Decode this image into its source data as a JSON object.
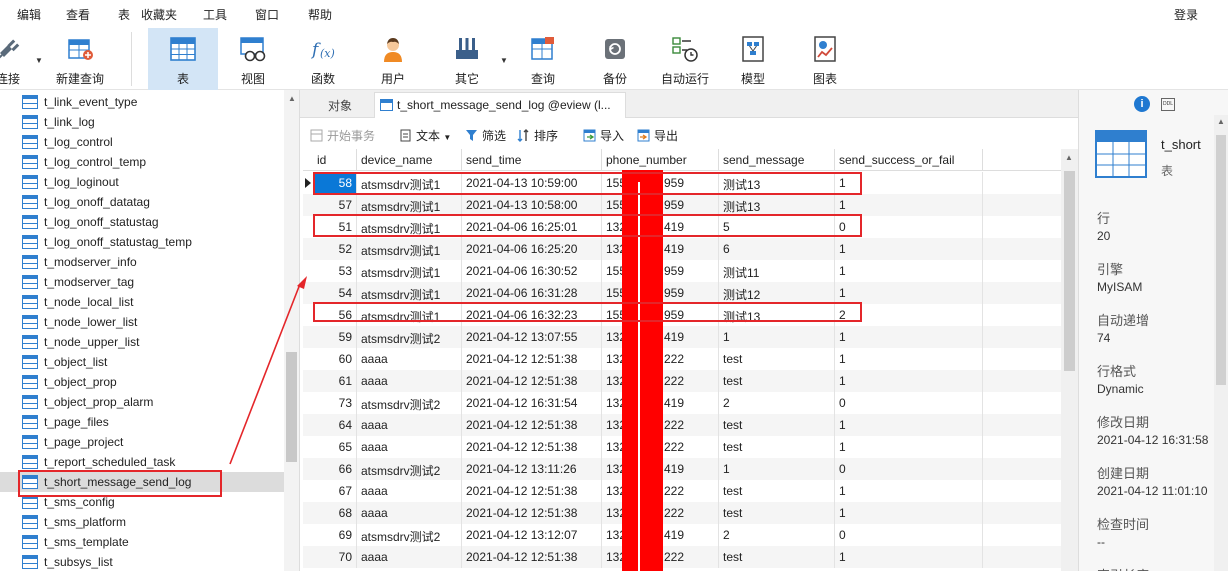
{
  "menu": [
    "编辑",
    "查看",
    "表",
    "收藏夹",
    "工具",
    "窗口",
    "帮助"
  ],
  "login": "登录",
  "toolbar": [
    {
      "label": "连接",
      "icon": "connection-icon"
    },
    {
      "label": "新建查询",
      "icon": "new-query-icon"
    },
    {
      "label": "表",
      "icon": "table-icon",
      "active": true
    },
    {
      "label": "视图",
      "icon": "view-icon"
    },
    {
      "label": "函数",
      "icon": "function-icon"
    },
    {
      "label": "用户",
      "icon": "user-icon"
    },
    {
      "label": "其它",
      "icon": "tools-icon"
    },
    {
      "label": "查询",
      "icon": "query-icon"
    },
    {
      "label": "备份",
      "icon": "backup-icon"
    },
    {
      "label": "自动运行",
      "icon": "automation-icon"
    },
    {
      "label": "模型",
      "icon": "model-icon"
    },
    {
      "label": "图表",
      "icon": "chart-icon"
    }
  ],
  "tree_items": [
    "t_link_event_type",
    "t_link_log",
    "t_log_control",
    "t_log_control_temp",
    "t_log_loginout",
    "t_log_onoff_datatag",
    "t_log_onoff_statustag",
    "t_log_onoff_statustag_temp",
    "t_modserver_info",
    "t_modserver_tag",
    "t_node_local_list",
    "t_node_lower_list",
    "t_node_upper_list",
    "t_object_list",
    "t_object_prop",
    "t_object_prop_alarm",
    "t_page_files",
    "t_page_project",
    "t_report_scheduled_task",
    "t_short_message_send_log",
    "t_sms_config",
    "t_sms_platform",
    "t_sms_template",
    "t_subsys_list"
  ],
  "selected_tree_index": 19,
  "tabs": {
    "objects": "对象",
    "active": "t_short_message_send_log @eview (l..."
  },
  "subtoolbar": {
    "begin_tx": "开始事务",
    "text": "文本",
    "filter": "筛选",
    "sort": "排序",
    "import": "导入",
    "export": "导出"
  },
  "columns": [
    "id",
    "device_name",
    "send_time",
    "phone_number",
    "send_message",
    "send_success_or_fail"
  ],
  "rows": [
    [
      "58",
      "atsmsdrv测试1",
      "2021-04-13 10:59:00",
      "155",
      "959",
      "测试13",
      "1"
    ],
    [
      "57",
      "atsmsdrv测试1",
      "2021-04-13 10:58:00",
      "155",
      "959",
      "测试13",
      "1"
    ],
    [
      "51",
      "atsmsdrv测试1",
      "2021-04-06 16:25:01",
      "132",
      "419",
      "5",
      "0"
    ],
    [
      "52",
      "atsmsdrv测试1",
      "2021-04-06 16:25:20",
      "132",
      "419",
      "6",
      "1"
    ],
    [
      "53",
      "atsmsdrv测试1",
      "2021-04-06 16:30:52",
      "155",
      "959",
      "测试11",
      "1"
    ],
    [
      "54",
      "atsmsdrv测试1",
      "2021-04-06 16:31:28",
      "155",
      "959",
      "测试12",
      "1"
    ],
    [
      "56",
      "atsmsdrv测试1",
      "2021-04-06 16:32:23",
      "155",
      "959",
      "测试13",
      "2"
    ],
    [
      "59",
      "atsmsdrv测试2",
      "2021-04-12 13:07:55",
      "132",
      "419",
      "1",
      "1"
    ],
    [
      "60",
      "aaaa",
      "2021-04-12 12:51:38",
      "132",
      "222",
      "test",
      "1"
    ],
    [
      "61",
      "aaaa",
      "2021-04-12 12:51:38",
      "132",
      "222",
      "test",
      "1"
    ],
    [
      "73",
      "atsmsdrv测试2",
      "2021-04-12 16:31:54",
      "132",
      "419",
      "2",
      "0"
    ],
    [
      "64",
      "aaaa",
      "2021-04-12 12:51:38",
      "132",
      "222",
      "test",
      "1"
    ],
    [
      "65",
      "aaaa",
      "2021-04-12 12:51:38",
      "132",
      "222",
      "test",
      "1"
    ],
    [
      "66",
      "atsmsdrv测试2",
      "2021-04-12 13:11:26",
      "132",
      "419",
      "1",
      "0"
    ],
    [
      "67",
      "aaaa",
      "2021-04-12 12:51:38",
      "132",
      "222",
      "test",
      "1"
    ],
    [
      "68",
      "aaaa",
      "2021-04-12 12:51:38",
      "132",
      "222",
      "test",
      "1"
    ],
    [
      "69",
      "atsmsdrv测试2",
      "2021-04-12 13:12:07",
      "132",
      "419",
      "2",
      "0"
    ],
    [
      "70",
      "aaaa",
      "2021-04-12 12:51:38",
      "132",
      "222",
      "test",
      "1"
    ]
  ],
  "highlighted_rows": [
    0,
    2,
    6
  ],
  "info": {
    "name": "t_short",
    "kind": "表",
    "fields": [
      {
        "label": "行",
        "value": "20"
      },
      {
        "label": "引擎",
        "value": "MyISAM"
      },
      {
        "label": "自动递增",
        "value": "74"
      },
      {
        "label": "行格式",
        "value": "Dynamic"
      },
      {
        "label": "修改日期",
        "value": "2021-04-12 16:31:58"
      },
      {
        "label": "创建日期",
        "value": "2021-04-12 11:01:10"
      },
      {
        "label": "检查时间",
        "value": "--"
      },
      {
        "label": "索引长度",
        "value": ""
      }
    ],
    "ddl_label": "DDL"
  },
  "colors": {
    "accent": "#0a78d7",
    "annotation": "#e4262a",
    "redaction": "#ff0000",
    "active_tool": "#d3e5f6"
  }
}
